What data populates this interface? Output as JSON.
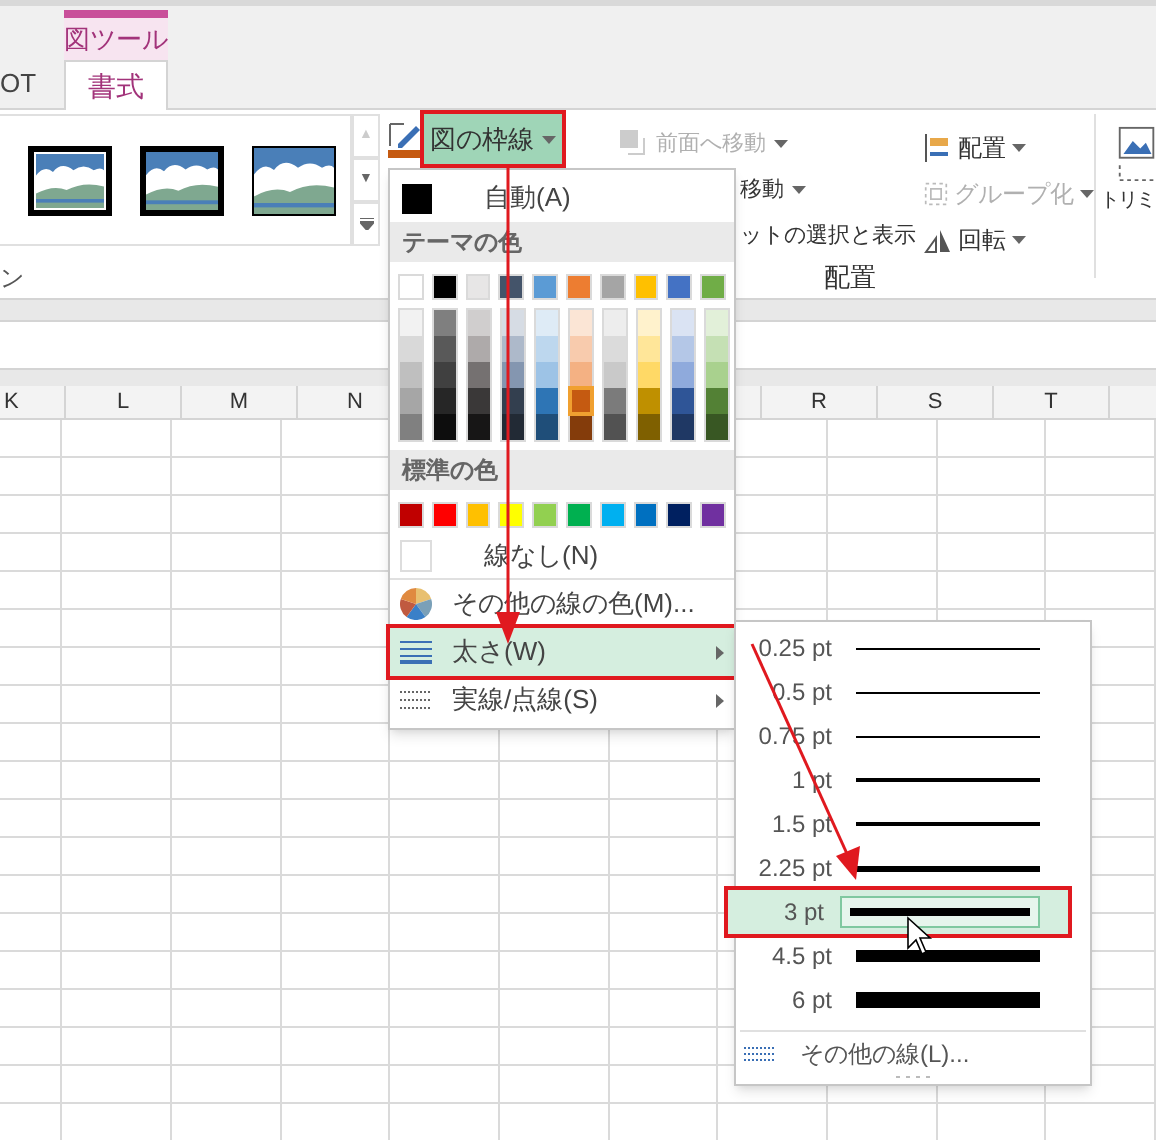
{
  "context_tab": {
    "label": "図ツール"
  },
  "tabs": [
    {
      "label": "OT",
      "selected": false
    },
    {
      "label": "書式",
      "selected": true
    }
  ],
  "ribbon": {
    "gallery_scroll": [
      "▲",
      "▼"
    ],
    "border_button": {
      "label": "図の枠線",
      "selected": true
    },
    "arrange_left": [
      {
        "label": "前面へ移動",
        "disabled": true
      },
      {
        "label": "移動",
        "disabled": false
      },
      {
        "label": "ットの選択と表示",
        "disabled": false
      }
    ],
    "arrange_right": [
      {
        "label": "配置",
        "kind": "align",
        "disabled": false
      },
      {
        "label": "グループ化",
        "kind": "group",
        "disabled": true
      },
      {
        "label": "回転",
        "kind": "rotate",
        "disabled": false
      }
    ],
    "group_labels": [
      "ン",
      "配置"
    ],
    "crop_label": "トリミ"
  },
  "sheet": {
    "columns_left": [
      "K",
      "L",
      "M",
      "N"
    ],
    "columns_right": [
      "R",
      "S",
      "T"
    ]
  },
  "border_menu": {
    "auto": "自動(A)",
    "theme_header": "テーマの色",
    "theme_colors": [
      {
        "color": "#ffffff"
      },
      {
        "color": "#000000"
      },
      {
        "color": "#e7e6e6"
      },
      {
        "color": "#44546a"
      },
      {
        "color": "#5b9bd5"
      },
      {
        "color": "#ed7d31"
      },
      {
        "color": "#a5a5a5"
      },
      {
        "color": "#ffc000"
      },
      {
        "color": "#4472c4"
      },
      {
        "color": "#70ad47"
      }
    ],
    "shades": [
      [
        {
          "color": "#f2f2f2",
          "selected": false
        },
        {
          "color": "#d9d9d9",
          "selected": false
        },
        {
          "color": "#bfbfbf",
          "selected": false
        },
        {
          "color": "#a6a6a6",
          "selected": false
        },
        {
          "color": "#808080",
          "selected": false
        }
      ],
      [
        {
          "color": "#7f7f7f",
          "selected": false
        },
        {
          "color": "#595959",
          "selected": false
        },
        {
          "color": "#404040",
          "selected": false
        },
        {
          "color": "#262626",
          "selected": false
        },
        {
          "color": "#0d0d0d",
          "selected": false
        }
      ],
      [
        {
          "color": "#d0cece",
          "selected": false
        },
        {
          "color": "#aeaaaa",
          "selected": false
        },
        {
          "color": "#757171",
          "selected": false
        },
        {
          "color": "#3a3838",
          "selected": false
        },
        {
          "color": "#171616",
          "selected": false
        }
      ],
      [
        {
          "color": "#d6dce4",
          "selected": false
        },
        {
          "color": "#adb9ca",
          "selected": false
        },
        {
          "color": "#8496b0",
          "selected": false
        },
        {
          "color": "#333f4f",
          "selected": false
        },
        {
          "color": "#222a35",
          "selected": false
        }
      ],
      [
        {
          "color": "#deebf6",
          "selected": false
        },
        {
          "color": "#bdd7ee",
          "selected": false
        },
        {
          "color": "#9dc3e6",
          "selected": false
        },
        {
          "color": "#2e75b5",
          "selected": false
        },
        {
          "color": "#1f4e79",
          "selected": false
        }
      ],
      [
        {
          "color": "#fbe5d5",
          "selected": false
        },
        {
          "color": "#f8cbad",
          "selected": false
        },
        {
          "color": "#f4b183",
          "selected": false
        },
        {
          "color": "#c55a11",
          "selected": true
        },
        {
          "color": "#843c0b",
          "selected": false
        }
      ],
      [
        {
          "color": "#ededed",
          "selected": false
        },
        {
          "color": "#dbdbdb",
          "selected": false
        },
        {
          "color": "#c9c9c9",
          "selected": false
        },
        {
          "color": "#7b7b7b",
          "selected": false
        },
        {
          "color": "#525252",
          "selected": false
        }
      ],
      [
        {
          "color": "#fff2cc",
          "selected": false
        },
        {
          "color": "#ffe699",
          "selected": false
        },
        {
          "color": "#ffd966",
          "selected": false
        },
        {
          "color": "#bf9000",
          "selected": false
        },
        {
          "color": "#7f6000",
          "selected": false
        }
      ],
      [
        {
          "color": "#dae3f3",
          "selected": false
        },
        {
          "color": "#b4c7e7",
          "selected": false
        },
        {
          "color": "#8faadc",
          "selected": false
        },
        {
          "color": "#2f5597",
          "selected": false
        },
        {
          "color": "#1f3864",
          "selected": false
        }
      ],
      [
        {
          "color": "#e2f0d9",
          "selected": false
        },
        {
          "color": "#c5e0b4",
          "selected": false
        },
        {
          "color": "#a9d18e",
          "selected": false
        },
        {
          "color": "#538135",
          "selected": false
        },
        {
          "color": "#385723",
          "selected": false
        }
      ]
    ],
    "standard_header": "標準の色",
    "standard_colors": [
      {
        "color": "#c00000"
      },
      {
        "color": "#ff0000"
      },
      {
        "color": "#ffc000"
      },
      {
        "color": "#ffff00"
      },
      {
        "color": "#92d050"
      },
      {
        "color": "#00b050"
      },
      {
        "color": "#00b0f0"
      },
      {
        "color": "#0070c0"
      },
      {
        "color": "#002060"
      },
      {
        "color": "#7030a0"
      }
    ],
    "no_line": "線なし(N)",
    "more_colors": "その他の線の色(M)...",
    "items": [
      {
        "label": "太さ(W)",
        "kind": "weight",
        "selected": true
      },
      {
        "label": "実線/点線(S)",
        "kind": "dash",
        "selected": false
      }
    ]
  },
  "weight_menu": {
    "items": [
      {
        "label": "0.25 pt",
        "selected": false
      },
      {
        "label": "0.5 pt",
        "selected": false
      },
      {
        "label": "0.75 pt",
        "selected": false
      },
      {
        "label": "1 pt",
        "selected": false
      },
      {
        "label": "1.5 pt",
        "selected": false
      },
      {
        "label": "2.25 pt",
        "selected": false
      },
      {
        "label": "3 pt",
        "selected": true
      },
      {
        "label": "4.5 pt",
        "selected": false
      },
      {
        "label": "6 pt",
        "selected": false
      }
    ],
    "more": "その他の線(L)..."
  }
}
